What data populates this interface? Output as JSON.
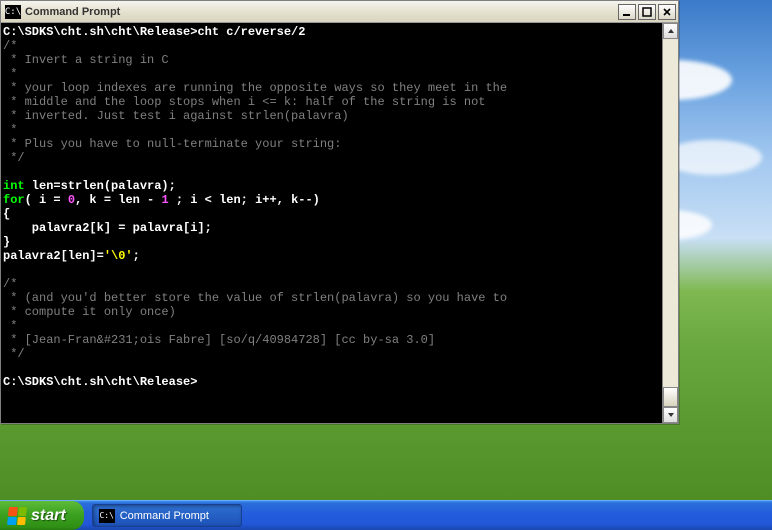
{
  "window": {
    "title": "Command Prompt",
    "icon_text": "C:\\"
  },
  "console": {
    "prompt1_path": "C:\\SDKS\\cht.sh\\cht\\Release>",
    "prompt1_cmd": "cht c/reverse/2",
    "c_open": "/*",
    "c_star": " *",
    "c_close": " */",
    "c_l1": " * Invert a string in C",
    "c_l2": " * your loop indexes are running the opposite ways so they meet in the",
    "c_l3": " * middle and the loop stops when i <= k: half of the string is not",
    "c_l4": " * inverted. Just test i against strlen(palavra)",
    "c_l5": " * Plus you have to null-terminate your string:",
    "kw_int": "int",
    "decl_rest": " len=strlen(palavra);",
    "kw_for": "for",
    "for_a": "( i = ",
    "num_0": "0",
    "for_b": ", k = len - ",
    "num_1": "1",
    "for_c": " ; i < len; i++, k--)",
    "brace_open": "{",
    "body_line": "    palavra2[k] = palavra[i];",
    "brace_close": "}",
    "term_a": "palavra2[len]=",
    "term_str": "'\\0'",
    "term_b": ";",
    "c2_l1": " * (and you'd better store the value of strlen(palavra) so you have to",
    "c2_l2": " * compute it only once)",
    "c2_l3": " * [Jean-Fran&#231;ois Fabre] [so/q/40984728] [cc by-sa 3.0]",
    "prompt2": "C:\\SDKS\\cht.sh\\cht\\Release>"
  },
  "taskbar": {
    "start_label": "start",
    "item_label": "Command Prompt",
    "item_icon_text": "C:\\"
  }
}
